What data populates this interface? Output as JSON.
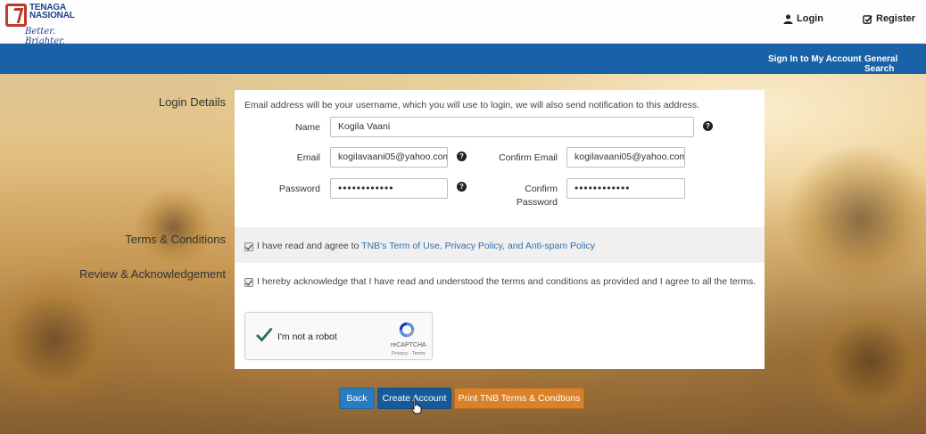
{
  "header": {
    "logo": {
      "name": "TENAGA NASIONAL",
      "tagline": "Better. Brighter."
    },
    "login_label": "Login",
    "register_label": "Register"
  },
  "nav": {
    "sign_in_label": "Sign In to My Account",
    "general_search_label": "General Search"
  },
  "sections": {
    "login_details": "Login Details",
    "terms": "Terms & Conditions",
    "review": "Review & Acknowledgement"
  },
  "form": {
    "intro": "Email address will be your username, which you will use to login, we will also send notification to this address.",
    "name_label": "Name",
    "name_value": "Kogila Vaani",
    "email_label": "Email",
    "email_value": "kogilavaani05@yahoo.com",
    "confirm_email_label": "Confirm Email",
    "confirm_email_value": "kogilavaani05@yahoo.com",
    "password_label": "Password",
    "password_value": "••••••••••••",
    "confirm_password_label_1": "Confirm",
    "confirm_password_label_2": "Password",
    "confirm_password_value": "••••••••••••",
    "help_glyph": "?"
  },
  "terms": {
    "checked": true,
    "text_prefix": "I have read and agree to ",
    "link_text": "TNB's Term of Use, Privacy Policy, and Anti-spam Policy"
  },
  "acknowledge": {
    "checked": true,
    "text": "I hereby acknowledge that I have read and understood the terms and conditions as provided and I agree to all the terms."
  },
  "captcha": {
    "label": "I'm not a robot",
    "brand": "reCAPTCHA",
    "links": "Privacy - Terms",
    "checked": true
  },
  "buttons": {
    "back": "Back",
    "create": "Create Account",
    "print": "Print TNB Terms & Condtions"
  },
  "colors": {
    "nav_blue": "#1a62a8",
    "back_button": "#2b7bc0",
    "create_button": "#175a9a",
    "print_button": "#d9822b",
    "link": "#2f6fab",
    "logo_red": "#c0392b"
  },
  "icons": {
    "login": "user-icon",
    "register": "edit-check-icon",
    "help": "question-circle-icon",
    "captcha_check": "check-icon",
    "captcha_logo": "recaptcha-icon",
    "cursor": "hand-pointer-icon"
  }
}
